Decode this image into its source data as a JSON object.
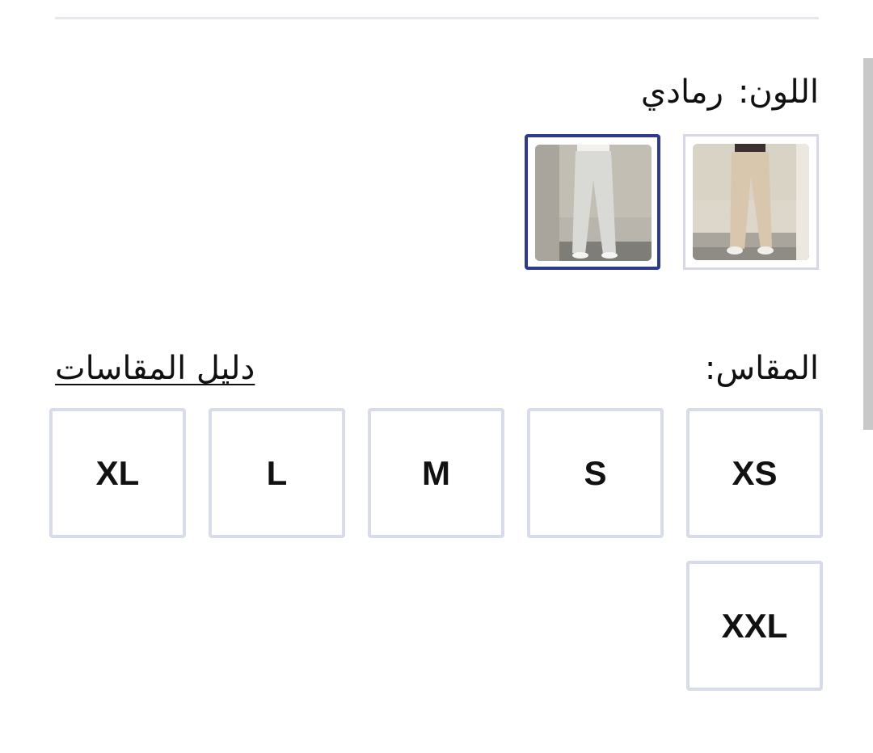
{
  "color": {
    "label": "اللون:",
    "selected_value": "رمادي",
    "swatches": [
      {
        "name": "beige",
        "selected": false
      },
      {
        "name": "grey",
        "selected": true
      }
    ],
    "selected_border_color": "#2e3a8c",
    "default_border_color": "#d6d8ea"
  },
  "size": {
    "label": "المقاس:",
    "guide_link": "دليل المقاسات",
    "options": [
      "XS",
      "S",
      "M",
      "L",
      "XL",
      "XXL"
    ]
  }
}
